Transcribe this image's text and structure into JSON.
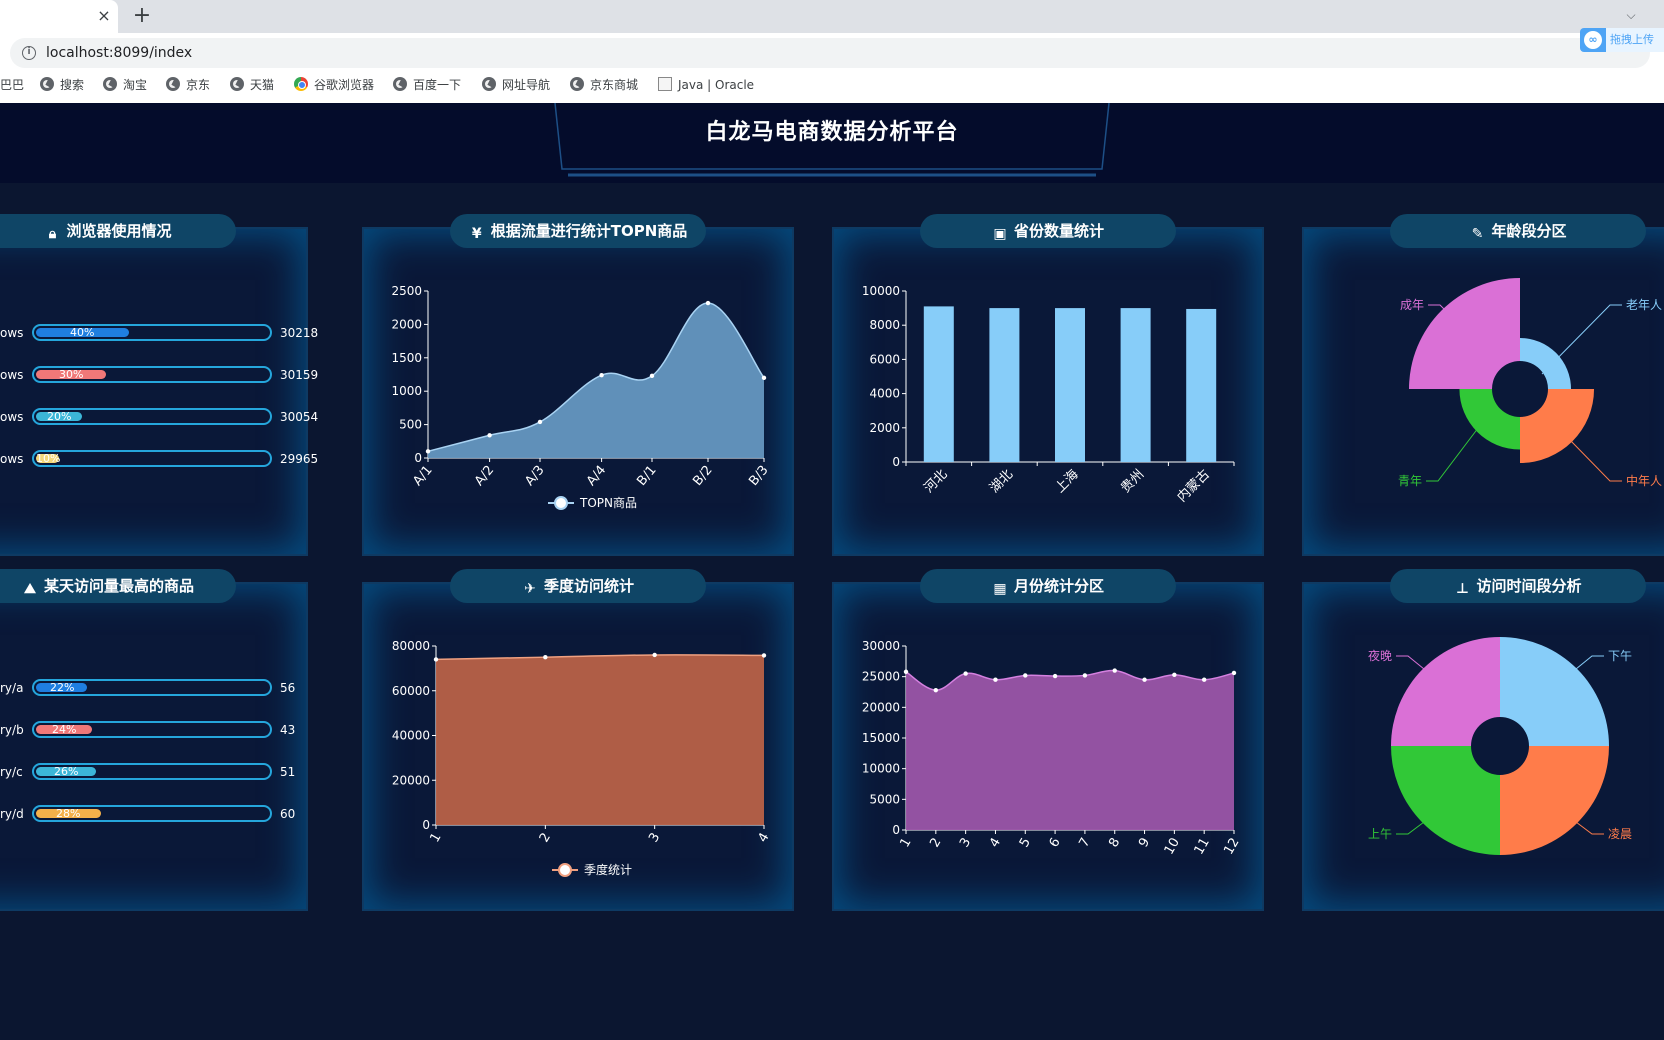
{
  "browser": {
    "tab_close": "×",
    "new_tab": "+",
    "chevron": "⌵",
    "url_host": "localhost",
    "url_rest": ":8099/index",
    "ext_label": "拖拽上传",
    "ext_icon": "∞",
    "bookmarks": [
      {
        "label": "巴巴",
        "icon": "none"
      },
      {
        "label": "搜索",
        "icon": "globe"
      },
      {
        "label": "淘宝",
        "icon": "globe"
      },
      {
        "label": "京东",
        "icon": "globe"
      },
      {
        "label": "天猫",
        "icon": "globe"
      },
      {
        "label": "谷歌浏览器",
        "icon": "chrome"
      },
      {
        "label": "百度一下",
        "icon": "globe"
      },
      {
        "label": "网址导航",
        "icon": "globe"
      },
      {
        "label": "京东商城",
        "icon": "globe"
      },
      {
        "label": "Java | Oracle",
        "icon": "java"
      }
    ]
  },
  "dashboard": {
    "title": "白龙马电商数据分析平台",
    "panels": {
      "browser_usage": {
        "title": "浏览器使用情况"
      },
      "topn": {
        "title": "根据流量进行统计TOPN商品"
      },
      "province": {
        "title": "省份数量统计"
      },
      "age": {
        "title": "年龄段分区"
      },
      "day_top": {
        "title": "某天访问量最高的商品"
      },
      "quarter": {
        "title": "季度访问统计"
      },
      "month": {
        "title": "月份统计分区"
      },
      "time": {
        "title": "访问时间段分析"
      }
    },
    "colors": {
      "accent": "#25a6dc",
      "panel_bg": "#0a1838",
      "head_bg": "#0f4566"
    }
  },
  "lists": {
    "browser_usage": [
      {
        "label": "ows",
        "percent": "40%",
        "fraction": 0.4,
        "value": "30218",
        "color": "#1f7ee0"
      },
      {
        "label": "ows",
        "percent": "30%",
        "fraction": 0.3,
        "value": "30159",
        "color": "#f07878"
      },
      {
        "label": "ows",
        "percent": "20%",
        "fraction": 0.2,
        "value": "30054",
        "color": "#3cb6d8"
      },
      {
        "label": "ows",
        "percent": "10%",
        "fraction": 0.1,
        "value": "29965",
        "color": "#f4d77a"
      }
    ],
    "day_top": [
      {
        "label": "ry/a",
        "percent": "22%",
        "fraction": 0.22,
        "value": "56",
        "color": "#1f7ee0"
      },
      {
        "label": "ry/b",
        "percent": "24%",
        "fraction": 0.24,
        "value": "43",
        "color": "#f07878"
      },
      {
        "label": "ry/c",
        "percent": "26%",
        "fraction": 0.26,
        "value": "51",
        "color": "#3cb6d8"
      },
      {
        "label": "ry/d",
        "percent": "28%",
        "fraction": 0.28,
        "value": "60",
        "color": "#f4b04a"
      }
    ]
  },
  "chart_data": [
    {
      "id": "topn",
      "type": "area",
      "categories": [
        "A/1",
        "A/2",
        "A/3",
        "A/4",
        "B/1",
        "B/2",
        "B/3"
      ],
      "x": [
        0,
        1.1,
        2.0,
        3.1,
        4.0,
        5.0,
        6.0
      ],
      "values": [
        100,
        340,
        540,
        1240,
        1230,
        2320,
        1200
      ],
      "series": [
        {
          "name": "TOPN商品"
        }
      ],
      "ylim": [
        0,
        2500
      ],
      "yticks": [
        0,
        500,
        1000,
        1500,
        2000,
        2500
      ],
      "color": "#6597c0",
      "line": "#a9d3f3",
      "legend": "bottom"
    },
    {
      "id": "province",
      "type": "bar",
      "categories": [
        "河北",
        "湖北",
        "上海",
        "贵州",
        "内蒙古"
      ],
      "values": [
        9100,
        9000,
        9000,
        9000,
        8950
      ],
      "ylim": [
        0,
        10000
      ],
      "yticks": [
        0,
        2000,
        4000,
        6000,
        8000,
        10000
      ],
      "color": "#87cdf9"
    },
    {
      "id": "age",
      "type": "pie",
      "labels": [
        "老年人",
        "中年人",
        "青年",
        "成年"
      ],
      "values": [
        5,
        20,
        10,
        65
      ],
      "colors": [
        "#87cdf9",
        "#ff7c4a",
        "#31c837",
        "#da70d6"
      ],
      "label_colors": [
        "#87cdf9",
        "#ff7c4a",
        "#31c837",
        "#da70d6"
      ]
    },
    {
      "id": "quarter",
      "type": "area",
      "categories": [
        "1",
        "2",
        "3",
        "4"
      ],
      "values": [
        74000,
        75000,
        76000,
        75800
      ],
      "series": [
        {
          "name": "季度统计"
        }
      ],
      "ylim": [
        0,
        80000
      ],
      "yticks": [
        0,
        20000,
        40000,
        60000,
        80000
      ],
      "color": "#b86147",
      "line": "#f0a080",
      "legend": "bottom"
    },
    {
      "id": "month",
      "type": "area",
      "categories": [
        "1",
        "2",
        "3",
        "4",
        "5",
        "6",
        "7",
        "8",
        "9",
        "10",
        "11",
        "12"
      ],
      "values": [
        25800,
        22800,
        25500,
        24500,
        25200,
        25100,
        25200,
        26000,
        24500,
        25300,
        24500,
        25600
      ],
      "ylim": [
        0,
        30000
      ],
      "yticks": [
        0,
        5000,
        10000,
        15000,
        20000,
        25000,
        30000
      ],
      "color": "#9b55a8",
      "line": "#d580e0"
    },
    {
      "id": "time",
      "type": "pie",
      "labels": [
        "下午",
        "凌晨",
        "上午",
        "夜晚"
      ],
      "values": [
        25,
        25,
        25,
        25
      ],
      "colors": [
        "#87cdf9",
        "#ff7c4a",
        "#31c837",
        "#da70d6"
      ],
      "label_colors": [
        "#87cdf9",
        "#ff7c4a",
        "#31c837",
        "#da70d6"
      ]
    }
  ]
}
